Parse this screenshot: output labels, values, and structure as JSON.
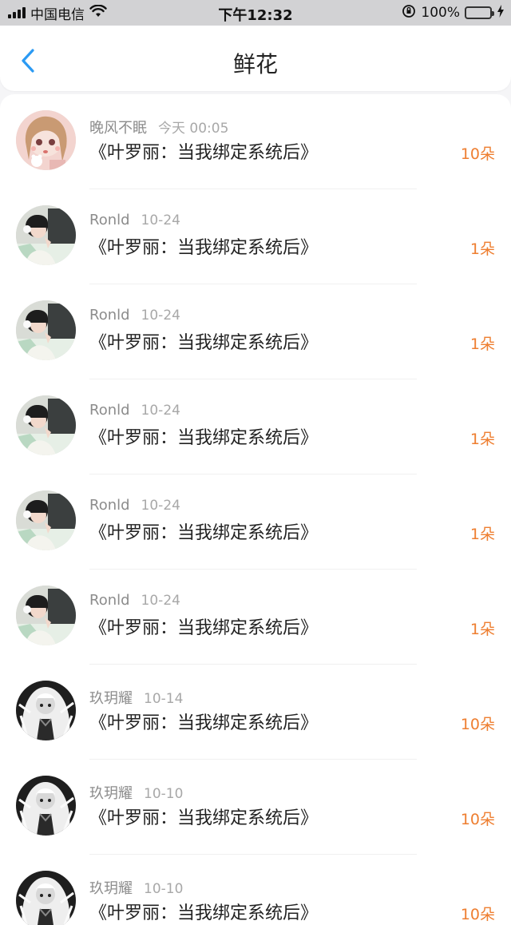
{
  "status_bar": {
    "carrier": "中国电信",
    "time": "下午12:32",
    "battery": "100%"
  },
  "nav": {
    "title": "鲜花"
  },
  "colors": {
    "accent": "#2b9af3",
    "amount": "#ee7e30"
  },
  "items": [
    {
      "name": "晚风不眠",
      "date": "今天 00:05",
      "title": "《叶罗丽：当我绑定系统后》",
      "amount": "10朵",
      "avatar": "anime-girl-pink"
    },
    {
      "name": "Ronld",
      "date": "10-24",
      "title": "《叶罗丽：当我绑定系统后》",
      "amount": "1朵",
      "avatar": "girl-photo"
    },
    {
      "name": "Ronld",
      "date": "10-24",
      "title": "《叶罗丽：当我绑定系统后》",
      "amount": "1朵",
      "avatar": "girl-photo"
    },
    {
      "name": "Ronld",
      "date": "10-24",
      "title": "《叶罗丽：当我绑定系统后》",
      "amount": "1朵",
      "avatar": "girl-photo"
    },
    {
      "name": "Ronld",
      "date": "10-24",
      "title": "《叶罗丽：当我绑定系统后》",
      "amount": "1朵",
      "avatar": "girl-photo"
    },
    {
      "name": "Ronld",
      "date": "10-24",
      "title": "《叶罗丽：当我绑定系统后》",
      "amount": "1朵",
      "avatar": "girl-photo"
    },
    {
      "name": "玖玥耀",
      "date": "10-14",
      "title": "《叶罗丽：当我绑定系统后》",
      "amount": "10朵",
      "avatar": "anime-girl-monochrome"
    },
    {
      "name": "玖玥耀",
      "date": "10-10",
      "title": "《叶罗丽：当我绑定系统后》",
      "amount": "10朵",
      "avatar": "anime-girl-monochrome"
    },
    {
      "name": "玖玥耀",
      "date": "10-10",
      "title": "《叶罗丽：当我绑定系统后》",
      "amount": "10朵",
      "avatar": "anime-girl-monochrome"
    }
  ]
}
